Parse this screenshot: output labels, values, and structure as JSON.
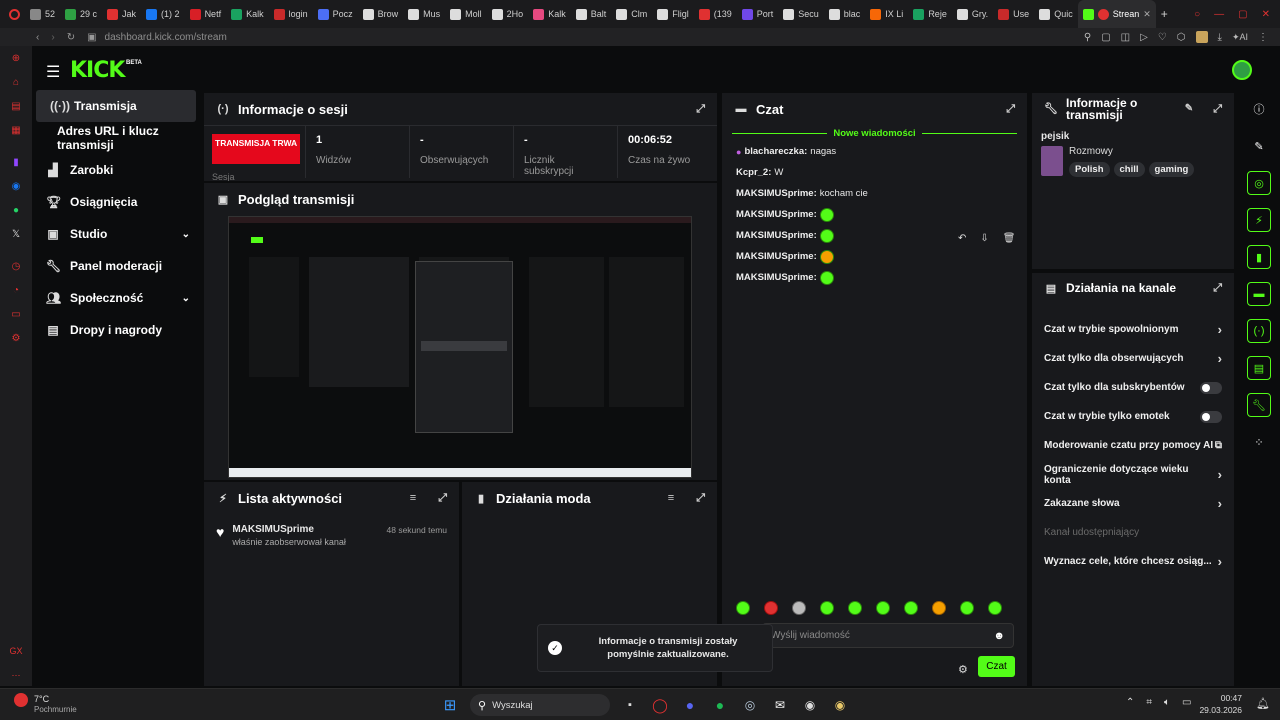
{
  "browser": {
    "tabs": [
      {
        "label": "52",
        "color": "#888"
      },
      {
        "label": "29 c",
        "color": "#2ea043"
      },
      {
        "label": "Jak",
        "color": "#e03131"
      },
      {
        "label": "(1) 2",
        "color": "#1877f2"
      },
      {
        "label": "Netf",
        "color": "#d81f26"
      },
      {
        "label": "Kalk",
        "color": "#1aa260"
      },
      {
        "label": "login",
        "color": "#c92a2a"
      },
      {
        "label": "Pocz",
        "color": "#4c6ef5"
      },
      {
        "label": "Brow",
        "color": "#ddd"
      },
      {
        "label": "Mus",
        "color": "#ddd"
      },
      {
        "label": "Moll",
        "color": "#ddd"
      },
      {
        "label": "2Ho",
        "color": "#ddd"
      },
      {
        "label": "Kalk",
        "color": "#e64980"
      },
      {
        "label": "Balt",
        "color": "#ddd"
      },
      {
        "label": "Clm",
        "color": "#ddd"
      },
      {
        "label": "Fligl",
        "color": "#ddd"
      },
      {
        "label": "(139",
        "color": "#e03131"
      },
      {
        "label": "Port",
        "color": "#7048e8"
      },
      {
        "label": "Secu",
        "color": "#ddd"
      },
      {
        "label": "blac",
        "color": "#ddd"
      },
      {
        "label": "IX Li",
        "color": "#f76707"
      },
      {
        "label": "Reje",
        "color": "#1aa260"
      },
      {
        "label": "Gry.",
        "color": "#ddd"
      },
      {
        "label": "Use",
        "color": "#c92a2a"
      },
      {
        "label": "Quic",
        "color": "#ddd"
      }
    ],
    "active_tab": "Strean",
    "url": "dashboard.kick.com/stream"
  },
  "brand": {
    "logo": "KICK",
    "beta": "BETA",
    "accent": "#53fc18"
  },
  "nav": {
    "items": [
      {
        "label": "Transmisja",
        "icon": "broadcast-icon",
        "active": true
      },
      {
        "label": "Adres URL i klucz transmisji",
        "icon": "",
        "active": false
      },
      {
        "label": "Zarobki",
        "icon": "earnings-icon",
        "active": false
      },
      {
        "label": "Osiągnięcia",
        "icon": "trophy-icon",
        "active": false
      },
      {
        "label": "Studio",
        "icon": "studio-icon",
        "active": false,
        "chevron": true
      },
      {
        "label": "Panel moderacji",
        "icon": "wrench-icon",
        "active": false
      },
      {
        "label": "Społeczność",
        "icon": "community-icon",
        "active": false,
        "chevron": true
      },
      {
        "label": "Dropy i nagrody",
        "icon": "gift-icon",
        "active": false
      }
    ]
  },
  "session": {
    "title": "Informacje o sesji",
    "live_badge": "TRANSMISJA TRWA",
    "live_sub": "Sesja",
    "stats": [
      {
        "value": "1",
        "label": "Widzów"
      },
      {
        "value": "-",
        "label": "Obserwujących"
      },
      {
        "value": "-",
        "label": "Licznik subskrypcji"
      },
      {
        "value": "00:06:52",
        "label": "Czas na żywo"
      }
    ]
  },
  "preview": {
    "title": "Podgląd transmisji"
  },
  "activity": {
    "title": "Lista aktywności",
    "items": [
      {
        "user": "MAKSIMUSprime",
        "text": "właśnie zaobserwował kanał",
        "time": "48 sekund temu"
      }
    ]
  },
  "mod_actions": {
    "title": "Działania moda"
  },
  "chat": {
    "title": "Czat",
    "new_messages": "Nowe wiadomości",
    "messages": [
      {
        "user": "blachareczka:",
        "text": "nagas",
        "badge": true,
        "emote": false
      },
      {
        "user": "Kcpr_2:",
        "text": "W",
        "badge": false,
        "emote": false
      },
      {
        "user": "MAKSIMUSprime:",
        "text": "kocham cie",
        "badge": false,
        "emote": false
      },
      {
        "user": "MAKSIMUSprime:",
        "text": "",
        "badge": false,
        "emote": true
      },
      {
        "user": "MAKSIMUSprime:",
        "text": "",
        "badge": false,
        "emote": true
      },
      {
        "user": "MAKSIMUSprime:",
        "text": "",
        "badge": false,
        "emote": true
      },
      {
        "user": "MAKSIMUSprime:",
        "text": "",
        "badge": false,
        "emote": true
      }
    ],
    "placeholder": "Wyślij wiadomość",
    "send_label": "Czat"
  },
  "toast": {
    "text": "Informacje o transmisji zostały pomyślnie zaktualizowane."
  },
  "stream_info": {
    "title": "Informacje o transmisji",
    "stream_title": "pejsik",
    "category": "Rozmowy",
    "tags": [
      "Polish",
      "chill",
      "gaming"
    ]
  },
  "channel_actions": {
    "title": "Działania na kanale",
    "items": [
      {
        "label": "Czat w trybie spowolnionym",
        "type": "chevron"
      },
      {
        "label": "Czat tylko dla obserwujących",
        "type": "chevron"
      },
      {
        "label": "Czat tylko dla subskrybentów",
        "type": "toggle"
      },
      {
        "label": "Czat w trybie tylko emotek",
        "type": "toggle"
      },
      {
        "label": "Moderowanie czatu przy pomocy AI",
        "type": "external"
      },
      {
        "label": "Ograniczenie dotyczące wieku konta",
        "type": "chevron"
      },
      {
        "label": "Zakazane słowa",
        "type": "chevron"
      },
      {
        "label": "Kanał udostępniający",
        "type": "disabled"
      },
      {
        "label": "Wyznacz cele, które chcesz osiąg...",
        "type": "chevron"
      }
    ]
  },
  "taskbar": {
    "weather_temp": "7°C",
    "weather_desc": "Pochmurnie",
    "search_placeholder": "Wyszukaj",
    "time": "00:47",
    "date": "29.03.2026"
  }
}
